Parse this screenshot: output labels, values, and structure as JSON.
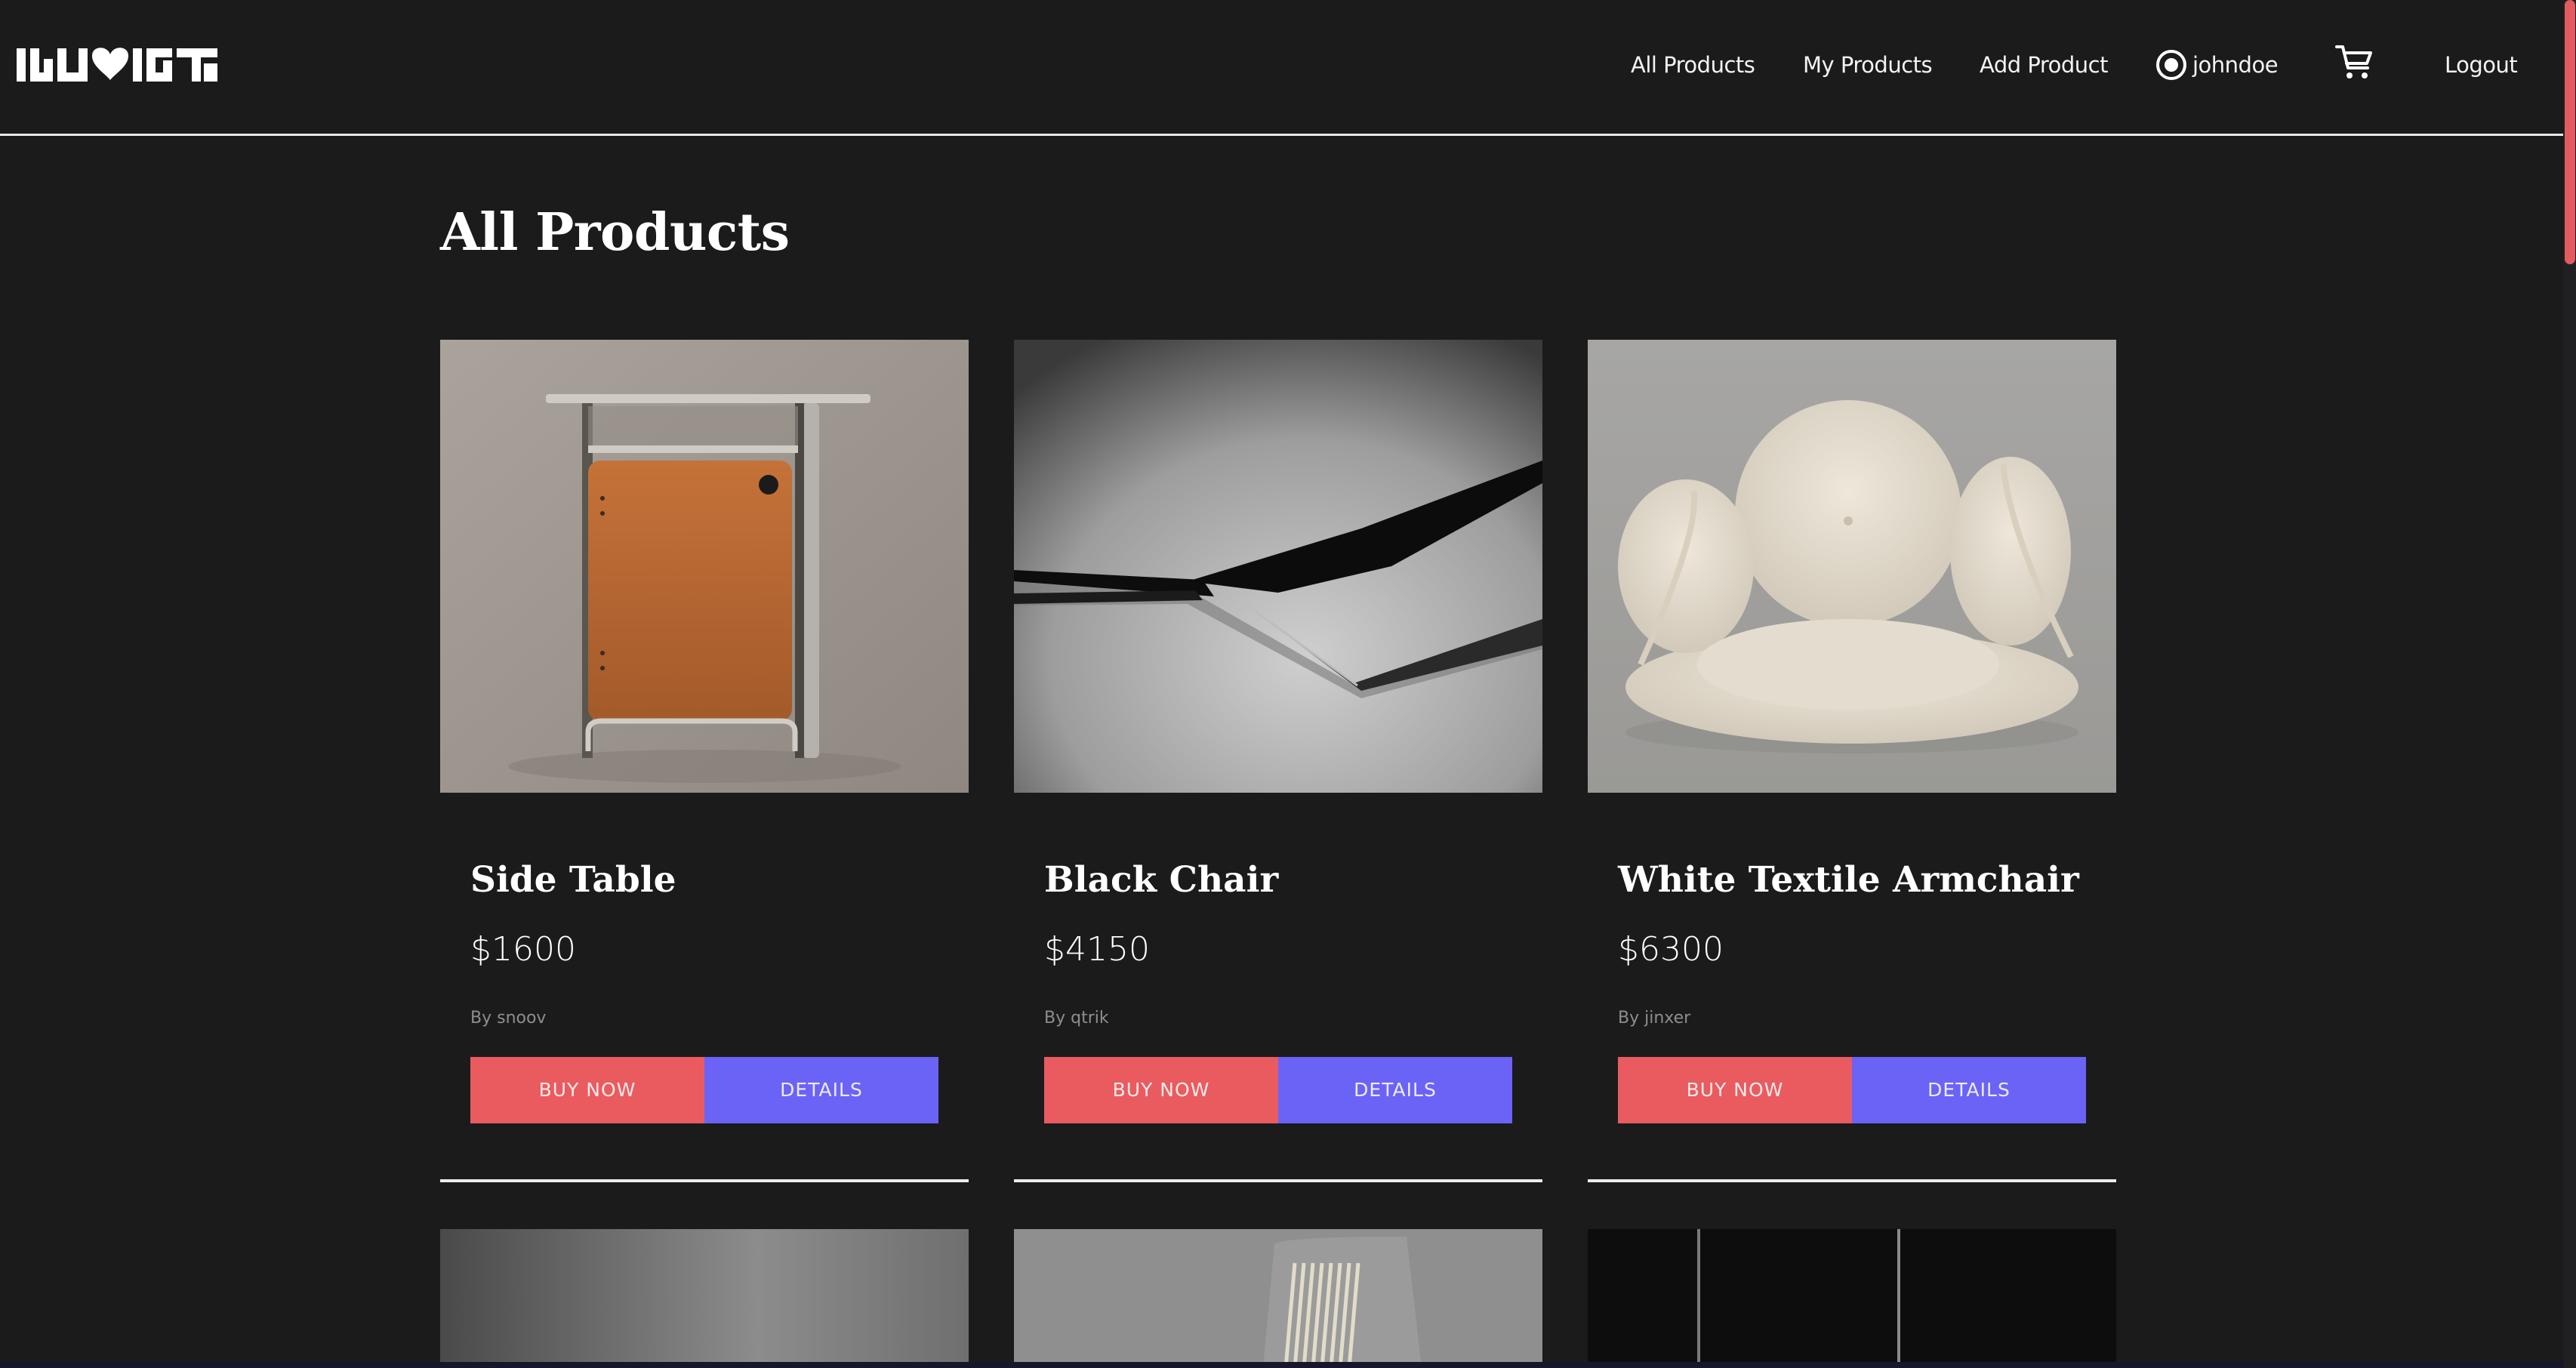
{
  "header": {
    "logo_text": "IHLUVIT",
    "nav": {
      "all_products": "All Products",
      "my_products": "My Products",
      "add_product": "Add Product",
      "username": "johndoe",
      "logout": "Logout"
    },
    "icons": [
      "user-icon",
      "cart-icon"
    ]
  },
  "main": {
    "title": "All Products",
    "products": [
      {
        "name": "Side Table",
        "price": "$1600",
        "author": "By snoov",
        "buy_label": "BUY NOW",
        "details_label": "DETAILS"
      },
      {
        "name": "Black Chair",
        "price": "$4150",
        "author": "By qtrik",
        "buy_label": "BUY NOW",
        "details_label": "DETAILS"
      },
      {
        "name": "White Textile Armchair",
        "price": "$6300",
        "author": "By jinxer",
        "buy_label": "BUY NOW",
        "details_label": "DETAILS"
      }
    ]
  },
  "colors": {
    "background": "#1b1b1c",
    "buy_button": "#ea5b60",
    "details_button": "#6b63f6",
    "scrollbar_thumb": "#e35a5f"
  }
}
